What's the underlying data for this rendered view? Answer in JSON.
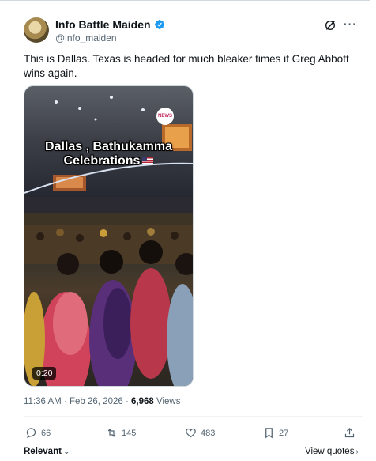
{
  "author": {
    "display_name": "Info Battle Maiden",
    "handle": "@info_maiden",
    "verified": true
  },
  "tweet": {
    "text": "This is Dallas. Texas is headed for much bleaker times if Greg Abbott wins again."
  },
  "media": {
    "caption_line1": "Dallas , Bathukamma",
    "caption_line2": "Celebrations",
    "duration": "0:20",
    "logo_text": "NEWS"
  },
  "meta": {
    "time": "11:36 AM",
    "separator": "·",
    "date": "Feb 26, 2026",
    "views_count": "6,968",
    "views_label": "Views"
  },
  "actions": {
    "replies": "66",
    "reposts": "145",
    "likes": "483",
    "bookmarks": "27"
  },
  "footer": {
    "sort_label": "Relevant",
    "view_quotes_label": "View quotes"
  },
  "icons": [
    "verified-badge-icon",
    "grok-icon",
    "more-icon",
    "reply-icon",
    "repost-icon",
    "like-icon",
    "bookmark-icon",
    "share-icon",
    "chevron-down-icon",
    "chevron-right-icon"
  ],
  "colors": {
    "verified": "#1d9bf0",
    "secondary_text": "#536471",
    "primary_text": "#0f1419"
  }
}
